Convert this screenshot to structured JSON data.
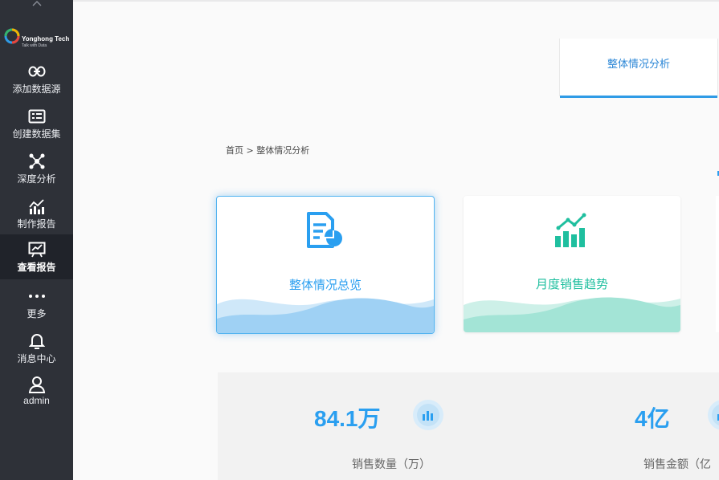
{
  "sidebar": {
    "collapse_icon": "chevron-up-icon",
    "logo": {
      "brand": "Yonghong Tech",
      "tagline": "Talk with Data"
    },
    "items": [
      {
        "label": "添加数据源",
        "icon": "link-icon"
      },
      {
        "label": "创建数据集",
        "icon": "dataset-icon"
      },
      {
        "label": "深度分析",
        "icon": "network-icon"
      },
      {
        "label": "制作报告",
        "icon": "chart-edit-icon"
      },
      {
        "label": "查看报告",
        "icon": "presentation-icon",
        "active": true
      },
      {
        "label": "更多",
        "icon": "more-icon"
      },
      {
        "label": "消息中心",
        "icon": "bell-icon"
      },
      {
        "label": "admin",
        "icon": "user-icon"
      }
    ]
  },
  "tabs": [
    {
      "label": "整体情况分析",
      "active": true
    }
  ],
  "breadcrumb": "首页 > 整体情况分析",
  "cards": [
    {
      "title": "整体情况总览",
      "icon": "report-pie-icon",
      "color": "#2a9ff0",
      "selected": true
    },
    {
      "title": "月度销售趋势",
      "icon": "bar-trend-icon",
      "color": "#1fbf9f",
      "selected": false
    }
  ],
  "stats": [
    {
      "value": "84.1万",
      "label": "销售数量（万）",
      "icon": "bar-chart-icon"
    },
    {
      "value": "4亿",
      "label": "销售金额（亿",
      "icon": "bar-chart-icon"
    }
  ],
  "colors": {
    "accent": "#2a9ff0",
    "green": "#1fbf9f",
    "sidebar_bg": "#2e3138"
  }
}
